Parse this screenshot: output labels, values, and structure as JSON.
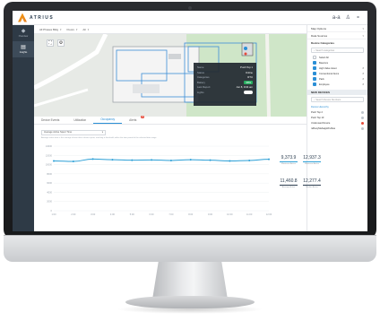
{
  "app": {
    "logo_text": "ATRIUS",
    "top_icons": [
      "a-a",
      "♙",
      "⚬"
    ]
  },
  "nav": {
    "items": [
      {
        "glyph": "◆",
        "label": "Overview",
        "active": false
      },
      {
        "glyph": "▤",
        "label": "Insights",
        "active": true
      }
    ]
  },
  "subbar": {
    "site": "All Phases Bldg",
    "floor": "Floors",
    "zone": "All"
  },
  "map": {
    "controls": [
      "⛶",
      "⚙"
    ],
    "popup": {
      "rows": [
        {
          "k": "Name",
          "v": "Push Top 1"
        },
        {
          "k": "Status",
          "v": "Online"
        },
        {
          "k": "Categories",
          "v": "RTU"
        },
        {
          "k": "Battery",
          "v": "98%"
        },
        {
          "k": "Last Report",
          "v": "Jun 8, 9:04 am"
        },
        {
          "k": "Lights",
          "v": ""
        }
      ]
    }
  },
  "right_panel": {
    "rows": [
      {
        "label": "Map Options"
      },
      {
        "label": "Data Sources"
      }
    ],
    "categories_head": "Device Categories",
    "categories_search": "Search categories",
    "categories": [
      {
        "label": "Select All",
        "checked": false,
        "count": ""
      },
      {
        "label": "Beacons",
        "checked": true,
        "count": ""
      },
      {
        "label": "High Value Asset",
        "checked": true,
        "count": "8"
      },
      {
        "label": "Conventional Items",
        "checked": true,
        "count": "8"
      },
      {
        "label": "Pack",
        "checked": true,
        "count": "8"
      },
      {
        "label": "Employee",
        "checked": true,
        "count": "8"
      }
    ],
    "devices_head": "NEW DEVICES",
    "devices_search": "Search Device Numbers",
    "devices": [
      {
        "label": "Device Hierarchy",
        "status": ""
      },
      {
        "label": "Push Top 2",
        "status": "#bfc5cc"
      },
      {
        "label": "Push Top 10",
        "status": "#bfc5cc"
      },
      {
        "label": "Underused Device",
        "status": "#e74c3c"
      },
      {
        "label": "reBuoyMahaqpiW+Mas",
        "status": "#bfc5cc"
      }
    ]
  },
  "tabs": [
    {
      "label": "Device Events",
      "active": false,
      "badge": ""
    },
    {
      "label": "Utilization",
      "active": false,
      "badge": ""
    },
    {
      "label": "Occupancy",
      "active": true,
      "badge": ""
    },
    {
      "label": "Alerts",
      "active": false,
      "badge": "8"
    }
  ],
  "chart_panel": {
    "select_label": "Average Active Spent Time",
    "note": "Average active time is the average of time that a device spent, reaching a threshold, within the time period of the selected date range"
  },
  "chart_data": {
    "type": "line",
    "x": [
      "1:00",
      "2:00",
      "3:00",
      "4:00",
      "5:00",
      "6:00",
      "7:00",
      "8:00",
      "9:00",
      "10:00",
      "11:00",
      "12:00"
    ],
    "series": [
      {
        "values": [
          10800,
          10700,
          11200,
          11050,
          10950,
          11000,
          10900,
          11050,
          10950,
          10800,
          10900,
          11150
        ]
      }
    ],
    "yticks": [
      "14000",
      "12000",
      "10000",
      "8000",
      "6000",
      "4000",
      "2000",
      "0"
    ],
    "ylim": [
      0,
      14000
    ],
    "color": "#2b9fd6"
  },
  "stats": [
    {
      "value": "9,373.9",
      "label": "Maximum Active",
      "color": "#2b9fd6"
    },
    {
      "value": "12,937.3",
      "label": "Maximum Active",
      "color": "#2b9fd6"
    },
    {
      "value": "11,460.8",
      "label": "Average Active",
      "color": "#2c3e50"
    },
    {
      "value": "12,277.4",
      "label": "Median Active",
      "color": "#2c3e50"
    }
  ]
}
